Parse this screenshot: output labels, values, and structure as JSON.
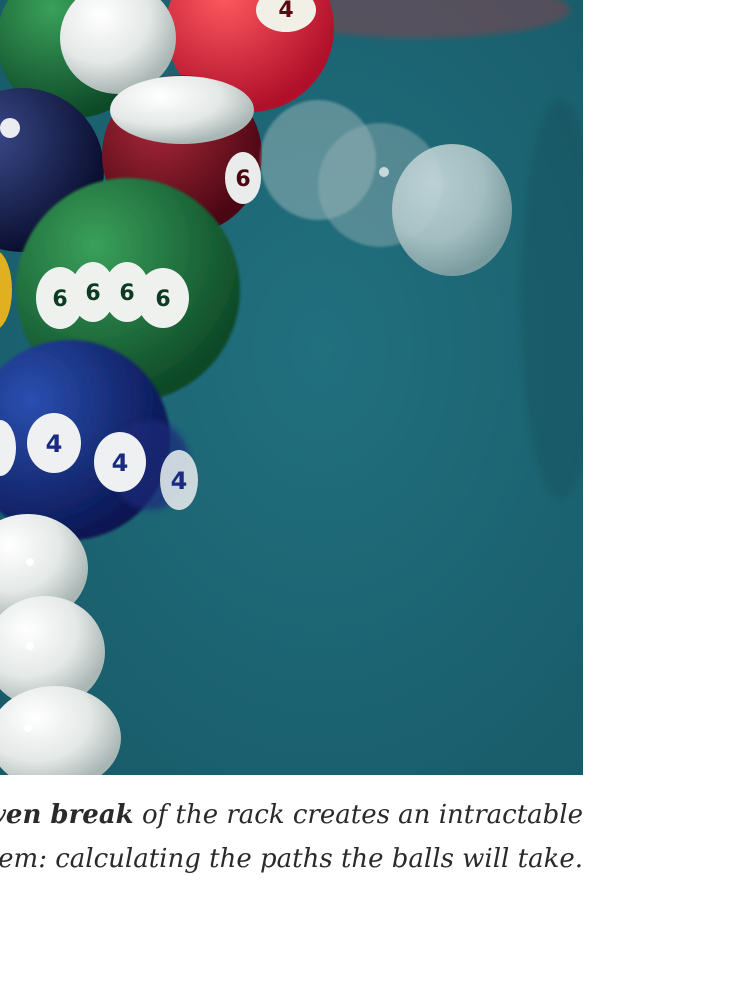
{
  "photo": {
    "subject": "billiard-balls-breaking-rack",
    "felt_color": "#1d6877",
    "ball_numbers": {
      "six_stripe": "6",
      "four_stripe": "4",
      "top_ball": "4",
      "maroon_ball": "6"
    }
  },
  "caption": {
    "bold_phrase": "ven break",
    "line1_rest": " of the rack creates an intractable",
    "line2": "em: calculating the paths the balls will take."
  }
}
